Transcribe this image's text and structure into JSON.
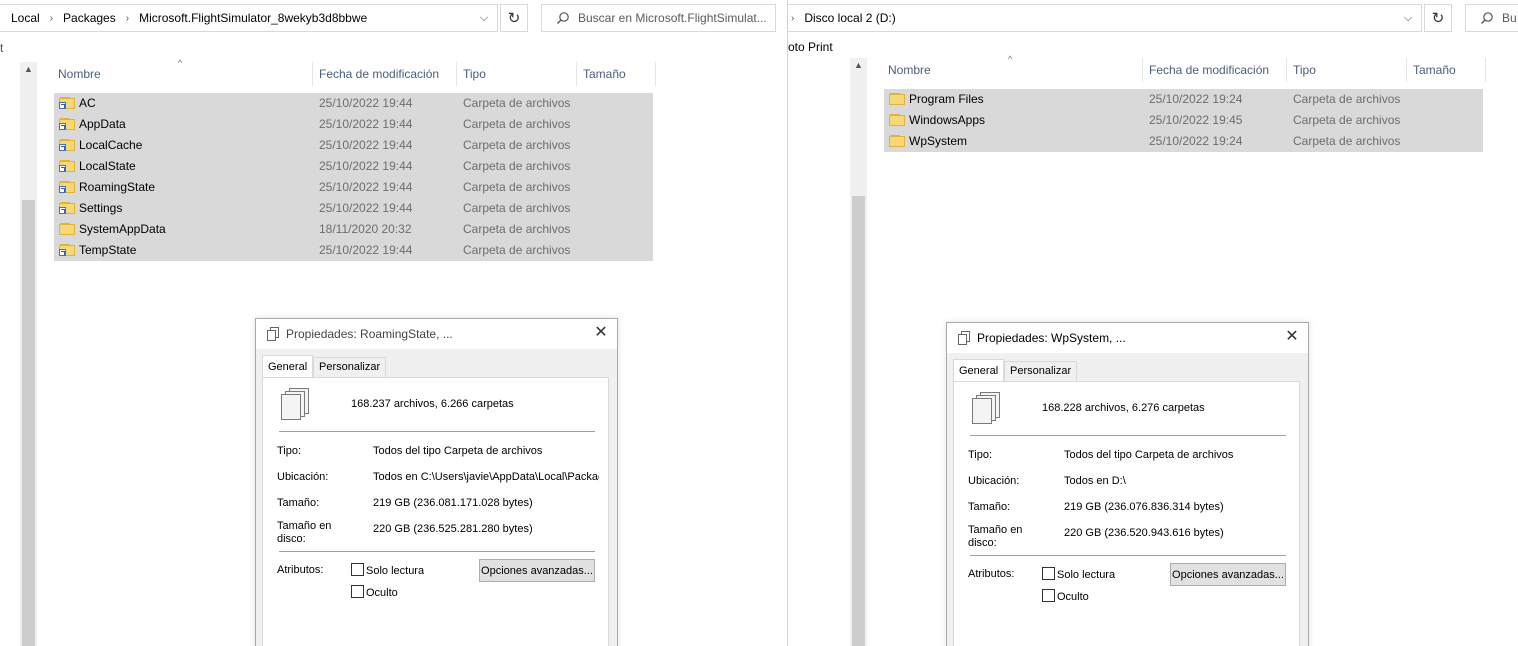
{
  "left": {
    "breadcrumb": [
      "Local",
      "Packages",
      "Microsoft.FlightSimulator_8wekyb3d8bbwe"
    ],
    "search_placeholder": "Buscar en Microsoft.FlightSimulat...",
    "ribbon_fragment": "t",
    "columns": {
      "name": "Nombre",
      "date": "Fecha de modificación",
      "type": "Tipo",
      "size": "Tamaño"
    },
    "rows": [
      {
        "name": "AC",
        "date": "25/10/2022 19:44",
        "type": "Carpeta de archivos",
        "shortcut": true
      },
      {
        "name": "AppData",
        "date": "25/10/2022 19:44",
        "type": "Carpeta de archivos",
        "shortcut": true
      },
      {
        "name": "LocalCache",
        "date": "25/10/2022 19:44",
        "type": "Carpeta de archivos",
        "shortcut": true
      },
      {
        "name": "LocalState",
        "date": "25/10/2022 19:44",
        "type": "Carpeta de archivos",
        "shortcut": true
      },
      {
        "name": "RoamingState",
        "date": "25/10/2022 19:44",
        "type": "Carpeta de archivos",
        "shortcut": true
      },
      {
        "name": "Settings",
        "date": "25/10/2022 19:44",
        "type": "Carpeta de archivos",
        "shortcut": true
      },
      {
        "name": "SystemAppData",
        "date": "18/11/2020 20:32",
        "type": "Carpeta de archivos",
        "shortcut": false
      },
      {
        "name": "TempState",
        "date": "25/10/2022 19:44",
        "type": "Carpeta de archivos",
        "shortcut": true
      }
    ],
    "dialog": {
      "title": "Propiedades: RoamingState, ...",
      "tabs": [
        "General",
        "Personalizar"
      ],
      "summary": "168.237 archivos, 6.266 carpetas",
      "type_label": "Tipo:",
      "type_value": "Todos del tipo Carpeta de archivos",
      "location_label": "Ubicación:",
      "location_value": "Todos en C:\\Users\\javie\\AppData\\Local\\Packag",
      "size_label": "Tamaño:",
      "size_value": "219 GB (236.081.171.028 bytes)",
      "disk_label_1": "Tamaño en",
      "disk_label_2": "disco:",
      "disk_value": "220 GB (236.525.281.280 bytes)",
      "attributes_label": "Atributos:",
      "readonly_label": "Solo lectura",
      "hidden_label": "Oculto",
      "advanced_button": "Opciones avanzadas..."
    }
  },
  "right": {
    "breadcrumb": [
      "Disco local 2 (D:)"
    ],
    "search_placeholder": "Bu",
    "ribbon_fragment": "oto Print",
    "columns": {
      "name": "Nombre",
      "date": "Fecha de modificación",
      "type": "Tipo",
      "size": "Tamaño"
    },
    "rows": [
      {
        "name": "Program Files",
        "date": "25/10/2022 19:24",
        "type": "Carpeta de archivos",
        "shortcut": false
      },
      {
        "name": "WindowsApps",
        "date": "25/10/2022 19:45",
        "type": "Carpeta de archivos",
        "shortcut": false
      },
      {
        "name": "WpSystem",
        "date": "25/10/2022 19:24",
        "type": "Carpeta de archivos",
        "shortcut": false
      }
    ],
    "dialog": {
      "title": "Propiedades: WpSystem, ...",
      "tabs": [
        "General",
        "Personalizar"
      ],
      "summary": "168.228 archivos, 6.276 carpetas",
      "type_label": "Tipo:",
      "type_value": "Todos del tipo Carpeta de archivos",
      "location_label": "Ubicación:",
      "location_value": "Todos en D:\\",
      "size_label": "Tamaño:",
      "size_value": "219 GB (236.076.836.314 bytes)",
      "disk_label_1": "Tamaño en",
      "disk_label_2": "disco:",
      "disk_value": "220 GB (236.520.943.616 bytes)",
      "attributes_label": "Atributos:",
      "readonly_label": "Solo lectura",
      "hidden_label": "Oculto",
      "advanced_button": "Opciones avanzadas..."
    }
  },
  "icons": {
    "folder": "folder-icon",
    "shortcut_overlay": "shortcut-arrow-icon",
    "search": "search-icon",
    "refresh": "refresh-icon",
    "dropdown": "chevron-down-icon",
    "close": "close-icon",
    "files": "multiple-files-icon"
  },
  "colors": {
    "selection": "#d9d9d9",
    "header_text": "#4c607a",
    "folder": "#f8d775"
  }
}
